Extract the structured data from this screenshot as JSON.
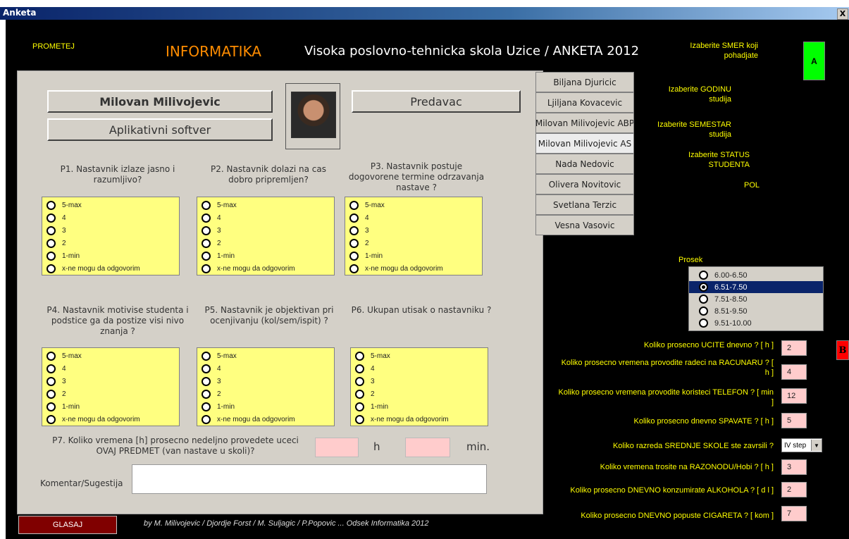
{
  "window": {
    "title": "Anketa",
    "close_label": "X"
  },
  "header": {
    "prometej": "PROMETEJ",
    "informatika": "INFORMATIKA",
    "school": "Visoka poslovno-tehnicka skola Uzice / ANKETA 2012"
  },
  "teacher": {
    "name": "Milovan Milivojevic",
    "role": "Predavac",
    "subject": "Aplikativni softver"
  },
  "tabs": [
    "Biljana Djuricic",
    "Ljiljana Kovacevic",
    "Milovan Milivojevic ABP",
    "Milovan Milivojevic AS",
    "Nada Nedovic",
    "Olivera Novitovic",
    "Svetlana Terzic",
    "Vesna Vasovic"
  ],
  "questions": [
    {
      "label": "P1. Nastavnik izlaze jasno i razumljivo?"
    },
    {
      "label": "P2. Nastavnik dolazi na cas dobro pripremljen?"
    },
    {
      "label": "P3. Nastavnik postuje dogovorene termine odrzavanja nastave ?"
    },
    {
      "label": "P4. Nastavnik motivise studenta i podstice ga da postize visi nivo znanja ?"
    },
    {
      "label": "P5. Nastavnik je objektivan pri ocenjivanju (kol/sem/ispit) ?"
    },
    {
      "label": "P6. Ukupan utisak o nastavniku ?"
    }
  ],
  "rating_options": [
    "5-max",
    "4",
    "3",
    "2",
    "1-min",
    "x-ne mogu da odgovorim"
  ],
  "p7": {
    "label": "P7. Koliko vremena [h] prosecno nedeljno provedete uceci OVAJ PREDMET (van nastave u skoli)?",
    "h_unit": "h",
    "min_unit": "min.",
    "h_value": "",
    "min_value": ""
  },
  "comment": {
    "label": "Komentar/Sugestija",
    "value": ""
  },
  "footer": {
    "vote_button": "GLASAJ",
    "credits": "by M. Milivojevic / Djordje Forst / M. Suljagic / P.Popovic ... Odsek Informatika 2012"
  },
  "right": {
    "smer": "Izaberite SMER koji pohadjate",
    "smer_btn": "A",
    "godina": "Izaberite GODINU studija",
    "semestar": "Izaberite SEMESTAR studija",
    "status": "Izaberite STATUS STUDENTA",
    "pol": "POL",
    "prosek_label": "Prosek",
    "prosek_options": [
      "6.00-6.50",
      "6.51-7.50",
      "7.51-8.50",
      "8.51-9.50",
      "9.51-10.00"
    ],
    "prosek_selected": "6.51-7.50",
    "b_btn": "B",
    "fields": [
      {
        "label": "Koliko prosecno UCITE dnevno ?  [ h ]",
        "value": "2"
      },
      {
        "label": "Koliko prosecno vremena provodite radeci na RACUNARU ? [ h ]",
        "value": "4"
      },
      {
        "label": "Koliko prosecno vremena provodite koristeci TELEFON ? [ min ]",
        "value": "12"
      },
      {
        "label": "Koliko prosecno dnevno SPAVATE ? [ h ]",
        "value": "5"
      },
      {
        "label": "Koliko razreda SREDNJE SKOLE ste zavrsili ?",
        "value": "IV step"
      },
      {
        "label": "Koliko vremena trosite na RAZONODU/Hobi ? [ h ]",
        "value": "3"
      },
      {
        "label": "Koliko prosecno DNEVNO konzumirate ALKOHOLA ? [ d l ]",
        "value": "2"
      },
      {
        "label": "Koliko prosecno DNEVNO popuste CIGARETA ? [ kom ]",
        "value": "7"
      }
    ]
  }
}
